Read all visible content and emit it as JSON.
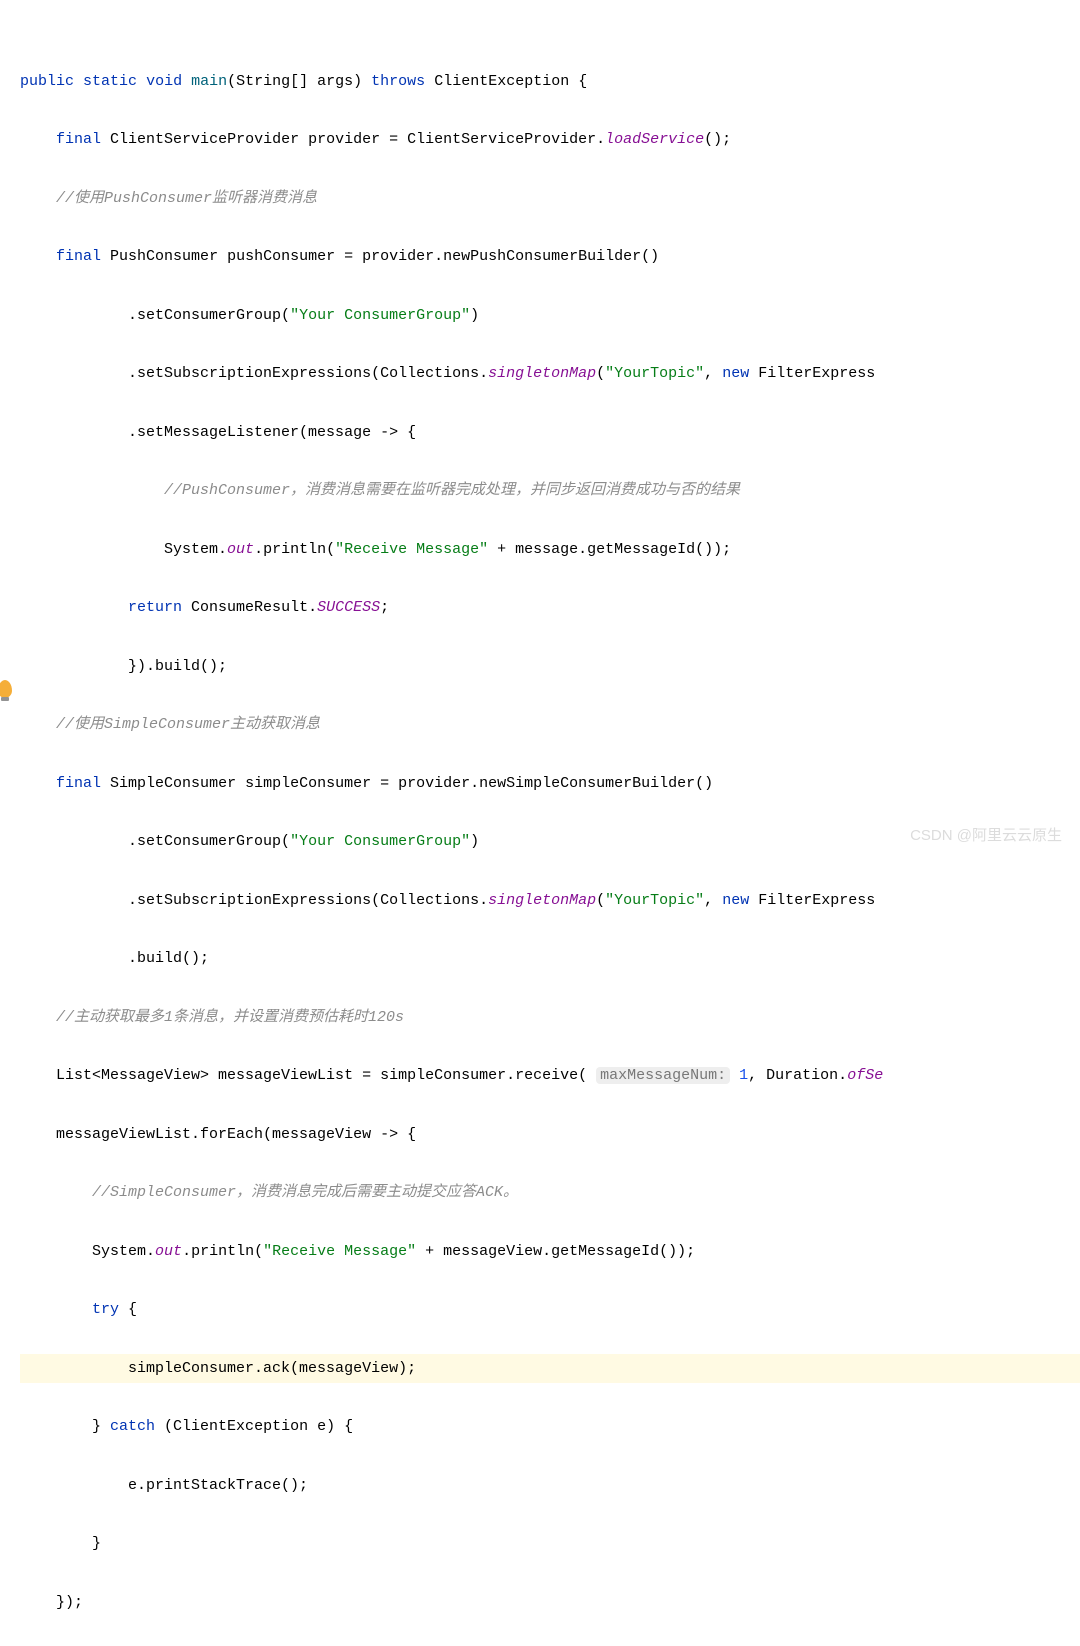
{
  "code": {
    "l1": {
      "public": "public",
      "static": "static",
      "void": "void",
      "main": "main",
      "params": "(String[] args)",
      "throws": "throws",
      "ex": "ClientException {"
    },
    "l2": {
      "final": "final",
      "t": "ClientServiceProvider provider = ClientServiceProvider.",
      "m": "loadService",
      "tail": "();"
    },
    "l3": "//使用PushConsumer监听器消费消息",
    "l4": {
      "final": "final",
      "t": "PushConsumer pushConsumer = provider.newPushConsumerBuilder()"
    },
    "l5": {
      "pre": "        .setConsumerGroup(",
      "s": "\"Your ConsumerGroup\"",
      "post": ")"
    },
    "l6": {
      "pre": "        .setSubscriptionExpressions(Collections.",
      "m": "singletonMap",
      "mid": "(",
      "s": "\"YourTopic\"",
      "post": ", ",
      "new": "new",
      "tail": " FilterExpress"
    },
    "l7": "        .setMessageListener(message -> {",
    "l8": "            //PushConsumer，消费消息需要在监听器完成处理，并同步返回消费成功与否的结果",
    "l9": {
      "pre": "            System.",
      "out": "out",
      "mid": ".println(",
      "s": "\"Receive Message\"",
      "post": " + message.getMessageId());"
    },
    "l10": {
      "ret": "return",
      "pre": "            ",
      "t": " ConsumeResult.",
      "m": "SUCCESS",
      "tail": ";"
    },
    "l11": "        }).build();",
    "l12": "//使用SimpleConsumer主动获取消息",
    "l13": {
      "final": "final",
      "t": "SimpleConsumer simpleConsumer = provider.newSimpleConsumerBuilder()"
    },
    "l14": {
      "pre": "        .setConsumerGroup(",
      "s": "\"Your ConsumerGroup\"",
      "post": ")"
    },
    "l15": {
      "pre": "        .setSubscriptionExpressions(Collections.",
      "m": "singletonMap",
      "mid": "(",
      "s": "\"YourTopic\"",
      "post": ", ",
      "new": "new",
      "tail": " FilterExpress"
    },
    "l16": "        .build();",
    "l17": "//主动获取最多1条消息，并设置消费预估耗时120s",
    "l18": {
      "pre": "List<MessageView> messageViewList = simpleConsumer.receive( ",
      "hint": "maxMessageNum:",
      "num": " 1",
      "post": ", Duration.",
      "m": "ofSe"
    },
    "l19": "messageViewList.forEach(messageView -> {",
    "l20": "    //SimpleConsumer，消费消息完成后需要主动提交应答ACK。",
    "l21": {
      "pre": "    System.",
      "out": "out",
      "mid": ".println(",
      "s": "\"Receive Message\"",
      "post": " + messageView.getMessageId());"
    },
    "l22": {
      "try": "try",
      "t": "    ",
      " post": " {"
    },
    "l23": "        simpleConsumer.ack(messageView);",
    "l24": {
      "pre": "    } ",
      "catch": "catch",
      "t": " (ClientException e) {"
    },
    "l25": "        e.printStackTrace();",
    "l26": "    }",
    "l27": "});"
  },
  "watermark": "CSDN @阿里云云原生"
}
